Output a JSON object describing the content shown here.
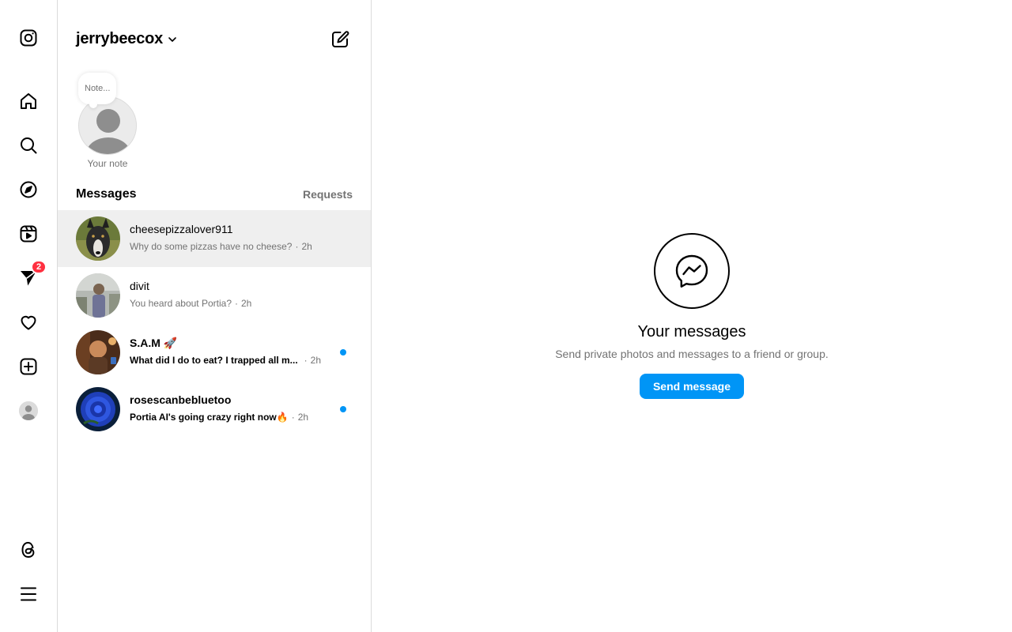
{
  "rail": {
    "items": [
      {
        "name": "instagram-logo-icon"
      },
      {
        "name": "home-icon"
      },
      {
        "name": "search-icon"
      },
      {
        "name": "explore-icon"
      },
      {
        "name": "reels-icon"
      },
      {
        "name": "messenger-icon",
        "badge": "2"
      },
      {
        "name": "heart-icon"
      },
      {
        "name": "create-icon"
      },
      {
        "name": "profile-avatar"
      },
      {
        "name": "threads-icon"
      },
      {
        "name": "menu-icon"
      }
    ],
    "badge_color": "#ff3040"
  },
  "inbox": {
    "account_name": "jerrybeecox",
    "note": {
      "bubble_text": "Note...",
      "label": "Your note"
    },
    "section_title": "Messages",
    "requests_label": "Requests",
    "threads": [
      {
        "name": "cheesepizzalover911",
        "preview": "Why do some pizzas have no cheese?",
        "time": "2h",
        "unread": false,
        "active": true
      },
      {
        "name": "divit",
        "preview": "You heard about Portia?",
        "time": "2h",
        "unread": false,
        "active": false
      },
      {
        "name": "S.A.M 🚀",
        "preview": "What did I do to eat? I trapped all m...",
        "time": "2h",
        "unread": true,
        "active": false
      },
      {
        "name": "rosescanbebluetoo",
        "preview": "Portia AI's going crazy right now🔥",
        "time": "2h",
        "unread": true,
        "active": false
      }
    ],
    "time_separator": "·"
  },
  "main": {
    "title": "Your messages",
    "subtitle": "Send private photos and messages to a friend or group.",
    "button_label": "Send message",
    "accent_color": "#0095f6"
  }
}
